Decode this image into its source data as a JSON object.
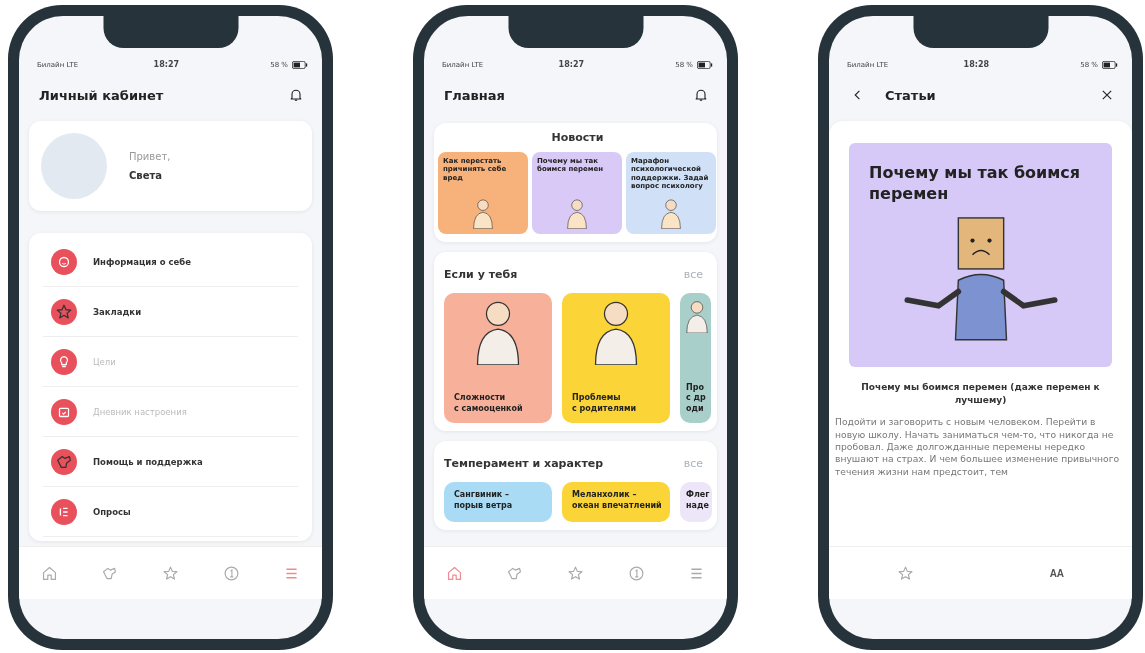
{
  "phones": [
    {
      "kind": "profile",
      "status": {
        "carrier": "Билайн LTE",
        "time": "18:27",
        "battery": "58 %"
      },
      "header": {
        "title": "Личный кабинет"
      },
      "profile": {
        "greeting": "Привет,",
        "name": "Света"
      },
      "menu": [
        {
          "label": "Информация о себе",
          "disabled": false
        },
        {
          "label": "Закладки",
          "disabled": false
        },
        {
          "label": "Цели",
          "disabled": true
        },
        {
          "label": "Дневник настроения",
          "disabled": true
        },
        {
          "label": "Помощь и поддержка",
          "disabled": false
        },
        {
          "label": "Опросы",
          "disabled": false
        }
      ],
      "tabbar": [
        {
          "selected": false
        },
        {
          "selected": false
        },
        {
          "selected": false
        },
        {
          "selected": false
        },
        {
          "selected": true
        }
      ]
    },
    {
      "kind": "home",
      "status": {
        "carrier": "Билайн LTE",
        "time": "18:27",
        "battery": "58 %"
      },
      "header": {
        "title": "Главная"
      },
      "sections": [
        {
          "kind": "news",
          "title": "Новости",
          "cards": [
            {
              "text": "Как перестать причинять себе вред",
              "color": "#f6b27a"
            },
            {
              "text": "Почему мы так боимся перемен",
              "color": "#d8c9f6"
            },
            {
              "text": "Марафон психологической поддержки. Задай вопрос психологу",
              "color": "#cfe0f7"
            }
          ]
        },
        {
          "kind": "topics",
          "title": "Если у тебя",
          "more": "все",
          "cards": [
            {
              "lines": [
                "Сложности",
                "с самооценкой"
              ],
              "color": "#f7b09a"
            },
            {
              "lines": [
                "Проблемы",
                "с родителями"
              ],
              "color": "#fbd437"
            },
            {
              "lines": [
                "Про",
                "с др",
                "оди"
              ],
              "color": "#a9cfcb"
            }
          ]
        },
        {
          "kind": "temper",
          "title": "Темперамент и характер",
          "more": "все",
          "cards": [
            {
              "lines": [
                "Сангвиник –",
                "порыв ветра"
              ],
              "color": "#a9dbf5"
            },
            {
              "lines": [
                "Меланхолик –",
                "океан впечатлений"
              ],
              "color": "#fbd437"
            },
            {
              "lines": [
                "Флег",
                "наде"
              ],
              "color": "#ece6f8"
            }
          ]
        }
      ],
      "tabbar": [
        {
          "selected": true
        },
        {
          "selected": false
        },
        {
          "selected": false
        },
        {
          "selected": false
        },
        {
          "selected": false
        }
      ]
    },
    {
      "kind": "article",
      "status": {
        "carrier": "Билайн LTE",
        "time": "18:28",
        "battery": "58 %"
      },
      "header": {
        "title": "Статьи"
      },
      "article": {
        "cover_title": "Почему мы так боимся перемен",
        "title": "Почему мы боимся перемен (даже перемен к лучшему)",
        "body": "Подойти и заговорить с новым человеком. Перейти в новую школу. Начать заниматься чем-то, что никогда не пробовал. Даже долгожданные перемены нередко внушают на страх. И чем большее изменение привычного течения жизни нам предстоит, тем"
      },
      "toolbar": {
        "font_button": "AA"
      }
    }
  ]
}
